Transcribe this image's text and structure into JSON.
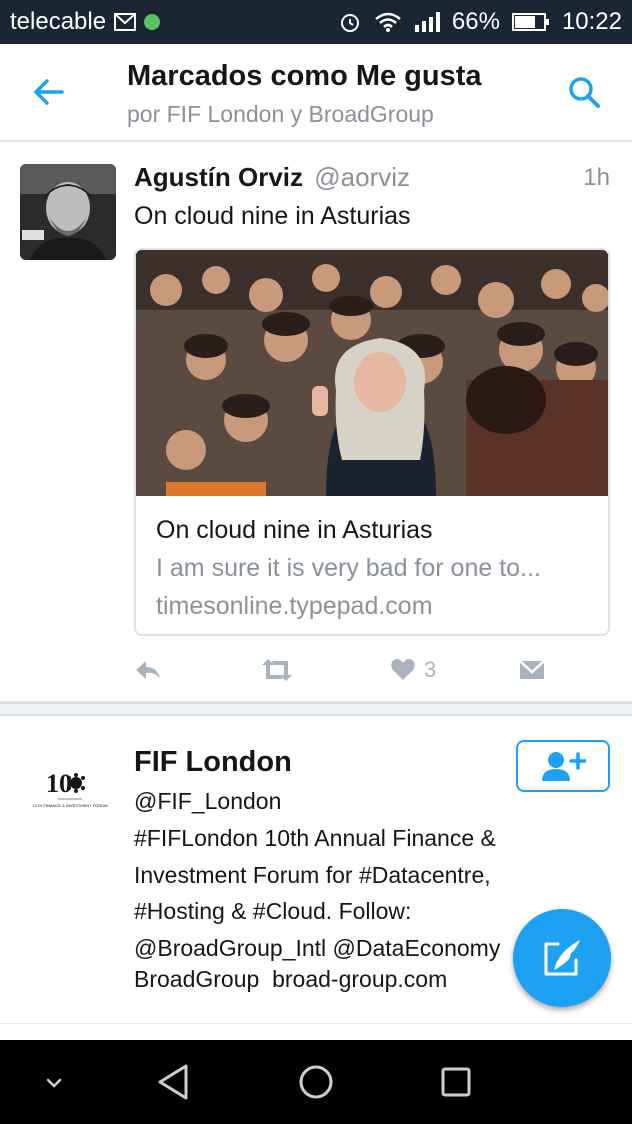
{
  "status_bar": {
    "carrier": "telecable",
    "battery": "66%",
    "time": "10:22"
  },
  "header": {
    "title": "Marcados como Me gusta",
    "subtitle": "por FIF London y BroadGroup"
  },
  "tweet": {
    "author_name": "Agustín Orviz",
    "author_handle": "@aorviz",
    "time": "1h",
    "text": "On cloud nine in Asturias",
    "card": {
      "title": "On cloud nine in Asturias",
      "description": "I am sure it is very bad for one to...",
      "domain": "timesonline.typepad.com"
    },
    "likes_count": "3"
  },
  "user": {
    "name": "FIF London",
    "handle": "@FIF_London",
    "bio": "#FIFLondon 10th Annual Finance & Investment Forum for #Datacentre, #Hosting & #Cloud. Follow: @BroadGroup_Intl @DataEconomy",
    "link_label": "BroadGroup",
    "link_url": "broad-group.com",
    "logo_text": "10",
    "logo_caption": "10TH FINANCE & INVESTMENT FORUM"
  },
  "colors": {
    "accent": "#1da1f2",
    "status_bar_bg": "#1a2634",
    "muted_text": "#8a9199"
  }
}
